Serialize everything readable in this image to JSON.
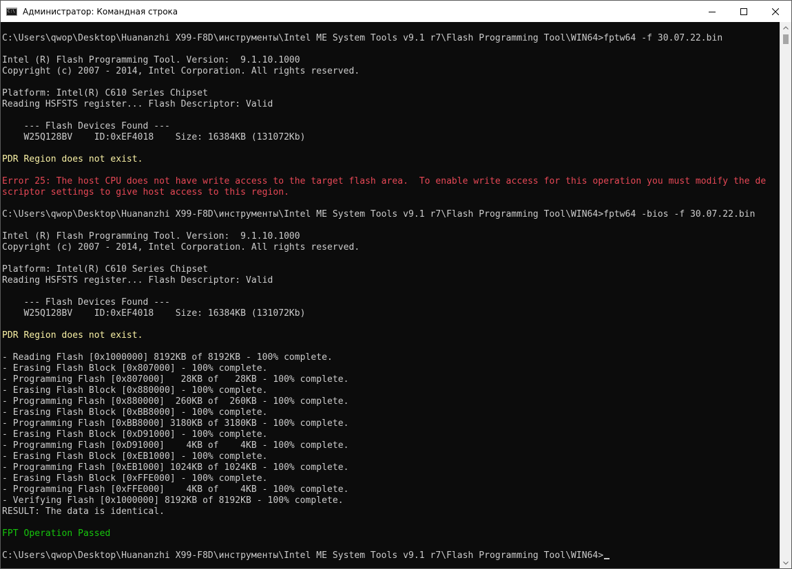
{
  "window": {
    "title": "Администратор: Командная строка",
    "app_icon_text": "C:\\"
  },
  "colors": {
    "default": "#cccccc",
    "yellow": "#f9f1a5",
    "red": "#e74856",
    "green": "#16c60c"
  },
  "icons": {
    "app": "cmd-console-icon",
    "minimize": "minimize-icon",
    "maximize": "maximize-icon",
    "close": "close-icon"
  },
  "console": {
    "lines": [
      {
        "text": "C:\\Users\\qwop\\Desktop\\Huananzhi X99-F8D\\инструменты\\Intel ME System Tools v9.1 r7\\Flash Programming Tool\\WIN64>fptw64 -f 30.07.22.bin",
        "color": "default"
      },
      {
        "text": "",
        "color": "default"
      },
      {
        "text": "Intel (R) Flash Programming Tool. Version:  9.1.10.1000",
        "color": "default"
      },
      {
        "text": "Copyright (c) 2007 - 2014, Intel Corporation. All rights reserved.",
        "color": "default"
      },
      {
        "text": "",
        "color": "default"
      },
      {
        "text": "Platform: Intel(R) C610 Series Chipset",
        "color": "default"
      },
      {
        "text": "Reading HSFSTS register... Flash Descriptor: Valid",
        "color": "default"
      },
      {
        "text": "",
        "color": "default"
      },
      {
        "text": "    --- Flash Devices Found ---",
        "color": "default"
      },
      {
        "text": "    W25Q128BV    ID:0xEF4018    Size: 16384KB (131072Kb)",
        "color": "default"
      },
      {
        "text": "",
        "color": "default"
      },
      {
        "text": "PDR Region does not exist.",
        "color": "yellow"
      },
      {
        "text": "",
        "color": "default"
      },
      {
        "text": "Error 25: The host CPU does not have write access to the target flash area.  To enable write access for this operation you must modify the de",
        "color": "red"
      },
      {
        "text": "scriptor settings to give host access to this region.",
        "color": "red"
      },
      {
        "text": "",
        "color": "default"
      },
      {
        "text": "C:\\Users\\qwop\\Desktop\\Huananzhi X99-F8D\\инструменты\\Intel ME System Tools v9.1 r7\\Flash Programming Tool\\WIN64>fptw64 -bios -f 30.07.22.bin",
        "color": "default"
      },
      {
        "text": "",
        "color": "default"
      },
      {
        "text": "Intel (R) Flash Programming Tool. Version:  9.1.10.1000",
        "color": "default"
      },
      {
        "text": "Copyright (c) 2007 - 2014, Intel Corporation. All rights reserved.",
        "color": "default"
      },
      {
        "text": "",
        "color": "default"
      },
      {
        "text": "Platform: Intel(R) C610 Series Chipset",
        "color": "default"
      },
      {
        "text": "Reading HSFSTS register... Flash Descriptor: Valid",
        "color": "default"
      },
      {
        "text": "",
        "color": "default"
      },
      {
        "text": "    --- Flash Devices Found ---",
        "color": "default"
      },
      {
        "text": "    W25Q128BV    ID:0xEF4018    Size: 16384KB (131072Kb)",
        "color": "default"
      },
      {
        "text": "",
        "color": "default"
      },
      {
        "text": "PDR Region does not exist.",
        "color": "yellow"
      },
      {
        "text": "",
        "color": "default"
      },
      {
        "text": "- Reading Flash [0x1000000] 8192KB of 8192KB - 100% complete.",
        "color": "default"
      },
      {
        "text": "- Erasing Flash Block [0x807000] - 100% complete.",
        "color": "default"
      },
      {
        "text": "- Programming Flash [0x807000]   28KB of   28KB - 100% complete.",
        "color": "default"
      },
      {
        "text": "- Erasing Flash Block [0x880000] - 100% complete.",
        "color": "default"
      },
      {
        "text": "- Programming Flash [0x880000]  260KB of  260KB - 100% complete.",
        "color": "default"
      },
      {
        "text": "- Erasing Flash Block [0xBB8000] - 100% complete.",
        "color": "default"
      },
      {
        "text": "- Programming Flash [0xBB8000] 3180KB of 3180KB - 100% complete.",
        "color": "default"
      },
      {
        "text": "- Erasing Flash Block [0xD91000] - 100% complete.",
        "color": "default"
      },
      {
        "text": "- Programming Flash [0xD91000]    4KB of    4KB - 100% complete.",
        "color": "default"
      },
      {
        "text": "- Erasing Flash Block [0xEB1000] - 100% complete.",
        "color": "default"
      },
      {
        "text": "- Programming Flash [0xEB1000] 1024KB of 1024KB - 100% complete.",
        "color": "default"
      },
      {
        "text": "- Erasing Flash Block [0xFFE000] - 100% complete.",
        "color": "default"
      },
      {
        "text": "- Programming Flash [0xFFE000]    4KB of    4KB - 100% complete.",
        "color": "default"
      },
      {
        "text": "- Verifying Flash [0x1000000] 8192KB of 8192KB - 100% complete.",
        "color": "default"
      },
      {
        "text": "RESULT: The data is identical.",
        "color": "default"
      },
      {
        "text": "",
        "color": "default"
      },
      {
        "text": "FPT Operation Passed",
        "color": "green"
      },
      {
        "text": "",
        "color": "default"
      }
    ],
    "prompt": "C:\\Users\\qwop\\Desktop\\Huananzhi X99-F8D\\инструменты\\Intel ME System Tools v9.1 r7\\Flash Programming Tool\\WIN64>"
  }
}
